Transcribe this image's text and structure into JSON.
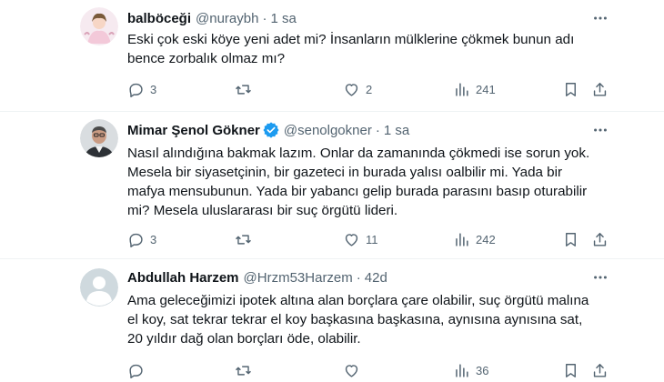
{
  "tweets": [
    {
      "name": "balböceği",
      "handle": "@nuraybh",
      "separator": "·",
      "time": "1 sa",
      "verified": false,
      "text": "Eski çok eski köye yeni adet mi? İnsanların mülklerine çökmek bunun adı\nbence zorbalık olmaz mı?",
      "reply_count": "3",
      "retweet_count": "",
      "like_count": "2",
      "view_count": "241"
    },
    {
      "name": "Mimar Şenol Gökner",
      "handle": "@senolgokner",
      "separator": "·",
      "time": "1 sa",
      "verified": true,
      "text": "Nasıl alındığına bakmak lazım. Onlar da zamanında çökmedi ise sorun yok.\nMesela bir siyasetçinin, bir gazeteci in burada yalısı oalbilir mi. Yada bir\nmafya mensubunun. Yada bir yabancı gelip burada parasını basıp oturabilir\nmi? Mesela uluslararası bir suç örgütü lideri.",
      "reply_count": "3",
      "retweet_count": "",
      "like_count": "11",
      "view_count": "242"
    },
    {
      "name": "Abdullah Harzem",
      "handle": "@Hrzm53Harzem",
      "separator": "·",
      "time": "42d",
      "verified": false,
      "text": "Ama geleceğimizi ipotek altına alan borçlara çare olabilir, suç örgütü malına\nel koy, sat tekrar tekrar el koy başkasına başkasına, aynısına aynısına sat,\n20 yıldır dağ olan borçları öde, olabilir.",
      "reply_count": "",
      "retweet_count": "",
      "like_count": "",
      "view_count": "36"
    }
  ],
  "icons": {
    "reply": "reply-icon",
    "retweet": "retweet-icon",
    "like": "heart-icon",
    "views": "views-icon",
    "bookmark": "bookmark-icon",
    "share": "share-icon",
    "more": "more-icon",
    "verified": "verified-badge-icon"
  },
  "colors": {
    "text": "#0f1419",
    "secondary": "#536471",
    "verified": "#1d9bf0",
    "divider": "#eff3f4"
  }
}
